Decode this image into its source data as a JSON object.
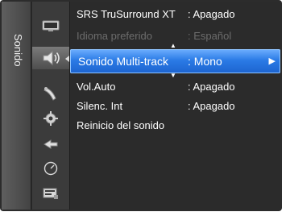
{
  "sidebar": {
    "category_label": "Sonido",
    "icons": [
      {
        "name": "picture-icon"
      },
      {
        "name": "sound-icon",
        "active": true
      },
      {
        "name": "channel-icon"
      },
      {
        "name": "setup-icon"
      },
      {
        "name": "input-icon"
      },
      {
        "name": "application-icon"
      },
      {
        "name": "support-icon"
      }
    ]
  },
  "menu": {
    "items": [
      {
        "label": "SRS TruSurround XT",
        "value": ": Apagado"
      },
      {
        "label": "Idioma preferido",
        "value": ": Español",
        "disabled": true
      },
      {
        "label": "Sonido Multi-track",
        "value": ": Mono",
        "selected": true
      },
      {
        "label": "Vol.Auto",
        "value": ": Apagado"
      },
      {
        "label": "Silenc. Int",
        "value": ": Apagado"
      },
      {
        "label": "Reinicio del sonido",
        "value": ""
      }
    ],
    "scroll_up_glyph": "▲",
    "scroll_down_glyph": "▼",
    "submenu_arrow_glyph": "▶"
  },
  "colors": {
    "selection": "#2b7be6",
    "text": "#ffffff",
    "disabled_text": "#6c6c6c",
    "background": "#2b2b2b"
  }
}
